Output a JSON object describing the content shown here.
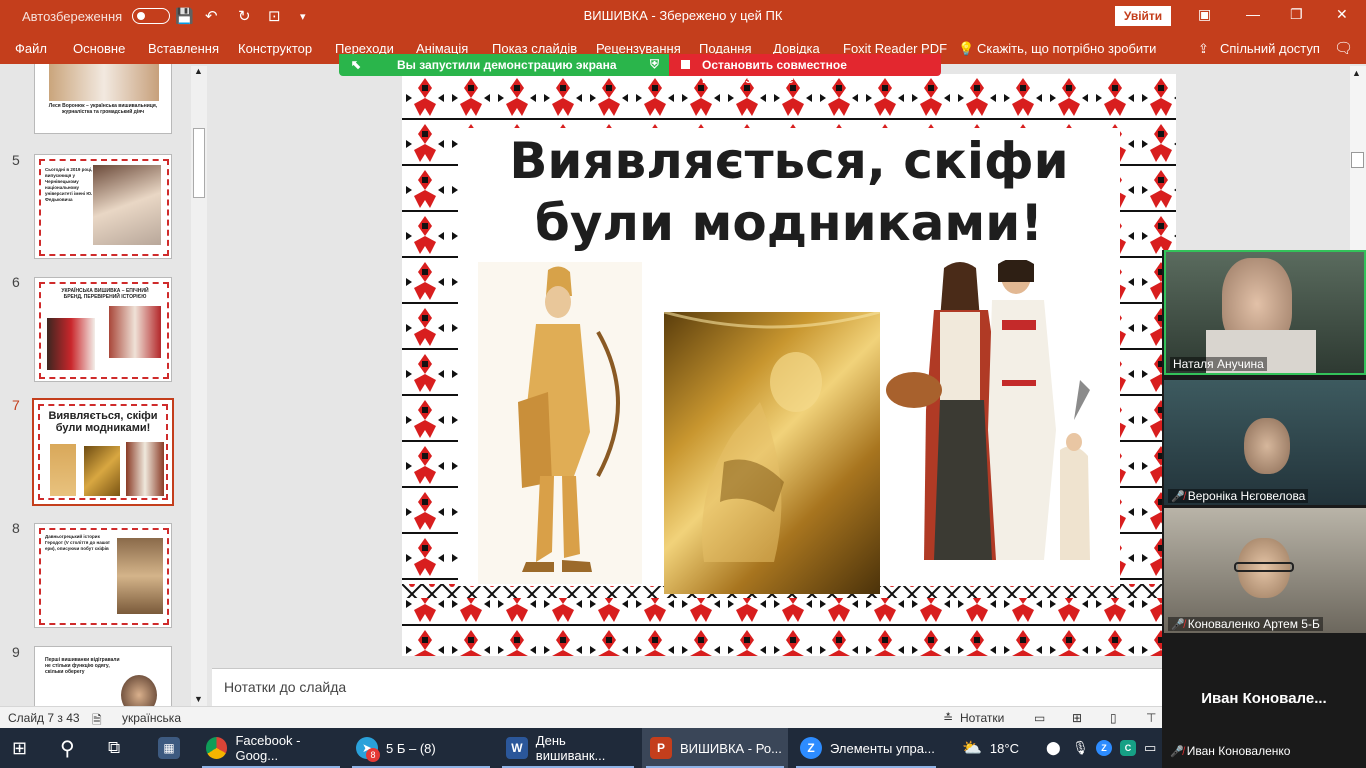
{
  "titlebar": {
    "autosave_label": "Автозбереження",
    "doc_title": "ВИШИВКА  -  Збережено у цей ПК",
    "sign_in": "Увійти"
  },
  "ribbon": {
    "tabs": [
      "Файл",
      "Основне",
      "Вставлення",
      "Конструктор",
      "Переходи",
      "Анімація",
      "Показ слайдів",
      "Рецензування",
      "Подання",
      "Довідка",
      "Foxit Reader PDF"
    ],
    "tell_me": "Скажіть, що потрібно зробити",
    "share": "Спільний доступ"
  },
  "screenshare": {
    "running": "Вы запустили демонстрацию экрана",
    "stop": "Остановить совместное использование"
  },
  "thumbnails": [
    {
      "num": "5",
      "text": "Сьогодні в 2019 році, випускниця у Чернівецькому національному університеті імені Ю. Федьковича"
    },
    {
      "num": "6",
      "text": "УКРАЇНСЬКА ВИШИВКА – ЕПІЧНИЙ БРЕНД, ПЕРЕВІРЕНИЙ ІСТОРІЄЮ"
    },
    {
      "num": "7",
      "text": "Виявляється, скіфи були модниками!"
    },
    {
      "num": "8",
      "text": "Давньогрецький історик Геродот (V століття до нашої ери), описуючи побут скіфів"
    },
    {
      "num": "9",
      "text": "Перші вишиванки відігравали не стільки функцію одягу, скільки оберегу"
    }
  ],
  "thumb_top": {
    "text": "Леся Воронюк – українська вишивальниця, журналістка та громадський діяч"
  },
  "slide": {
    "title_line1": "Виявляється, скіфи",
    "title_line2": "були модниками!"
  },
  "notes": {
    "placeholder": "Нотатки до слайда"
  },
  "status": {
    "slide_counter": "Слайд 7 з 43",
    "language": "українська",
    "notes_btn": "Нотатки"
  },
  "participants": [
    {
      "name": "Наталя Анучина"
    },
    {
      "name": "Вероніка Нєговелова"
    },
    {
      "name": "Коноваленко Артем 5-Б"
    }
  ],
  "active_user": {
    "big": "Иван  Коновале...",
    "small": "Иван Коноваленко"
  },
  "taskbar": {
    "items": [
      "Facebook - Goog...",
      "5 Б – (8)",
      "День вишиванк...",
      "ВИШИВКА - Ро...",
      "Элементы упра..."
    ],
    "badge": "8",
    "temp": "18°C"
  },
  "colors": {
    "accent": "#c43e1c",
    "share_green": "#2ab54b",
    "stop_red": "#e3272f"
  }
}
